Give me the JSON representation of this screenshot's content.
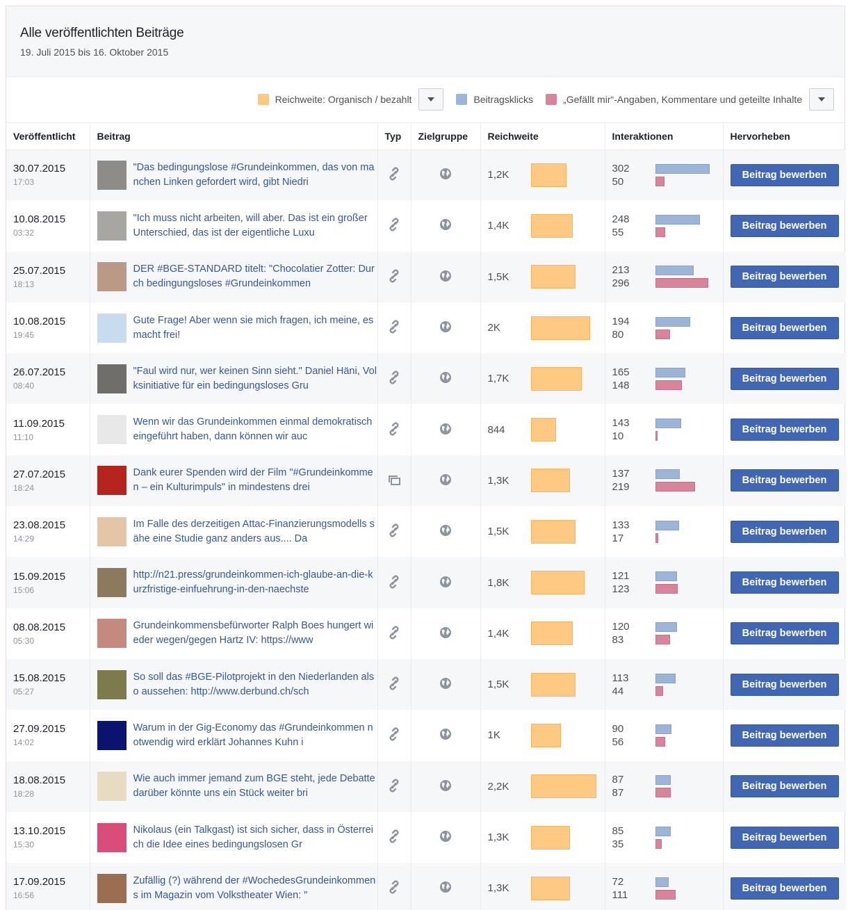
{
  "header": {
    "title": "Alle veröffentlichten Beiträge",
    "date_range": "19. Juli 2015 bis 16. Oktober 2015"
  },
  "legend": {
    "reach_label": "Reichweite: Organisch / bezahlt",
    "clicks_label": "Beitragsklicks",
    "engagement_label": "„Gefällt mir“-Angaben, Kommentare und geteilte Inhalte",
    "colors": {
      "reach": "#fec983",
      "clicks": "#9cb4d8",
      "engagement": "#d8849a"
    }
  },
  "columns": [
    "Veröffentlicht",
    "Beitrag",
    "Typ",
    "Zielgruppe",
    "Reichweite",
    "Interaktionen",
    "Hervorheben"
  ],
  "boost_label": "Beitrag bewerben",
  "rows": [
    {
      "date": "30.07.2015",
      "time": "17:03",
      "text": "\"Das bedingungslose #Grundeinkommen, das von manchen Linken gefordert wird, gibt Niedri",
      "type_icon": "link-icon",
      "reach": "1,2K",
      "reach_value": 1200,
      "clicks": 302,
      "engagement": 50,
      "thumb": "#8d8c88"
    },
    {
      "date": "10.08.2015",
      "time": "03:32",
      "text": "\"Ich muss nicht arbeiten, will aber. Das ist ein großer Unterschied, das ist der eigentliche Luxu",
      "type_icon": "link-icon",
      "reach": "1,4K",
      "reach_value": 1400,
      "clicks": 248,
      "engagement": 55,
      "thumb": "#a8a6a2"
    },
    {
      "date": "25.07.2015",
      "time": "18:13",
      "text": "DER #BGE-STANDARD titelt: \"Chocolatier Zotter: Durch bedingungsloses #Grundeinkommen",
      "type_icon": "link-icon",
      "reach": "1,5K",
      "reach_value": 1500,
      "clicks": 213,
      "engagement": 296,
      "thumb": "#b89a86"
    },
    {
      "date": "10.08.2015",
      "time": "19:45",
      "text": "Gute Frage! Aber wenn sie mich fragen, ich meine, es macht frei!",
      "type_icon": "link-icon",
      "reach": "2K",
      "reach_value": 2000,
      "clicks": 194,
      "engagement": 80,
      "thumb": "#c9dbef"
    },
    {
      "date": "26.07.2015",
      "time": "08:40",
      "text": "\"Faul wird nur, wer keinen Sinn sieht.\" Daniel Häni, Volksinitiative für ein bedingungsloses Gru",
      "type_icon": "link-icon",
      "reach": "1,7K",
      "reach_value": 1700,
      "clicks": 165,
      "engagement": 148,
      "thumb": "#6f6e6a"
    },
    {
      "date": "11.09.2015",
      "time": "11:10",
      "text": "Wenn wir das Grundeinkommen einmal demokratisch eingeführt haben, dann können wir auc",
      "type_icon": "link-icon",
      "reach": "844",
      "reach_value": 844,
      "clicks": 143,
      "engagement": 10,
      "thumb": "#e8e8e8"
    },
    {
      "date": "27.07.2015",
      "time": "18:24",
      "text": "Dank eurer Spenden wird der Film \"#Grundeinkommen – ein Kulturimpuls\" in mindestens drei",
      "type_icon": "album-icon",
      "reach": "1,3K",
      "reach_value": 1300,
      "clicks": 137,
      "engagement": 219,
      "thumb": "#b5241c"
    },
    {
      "date": "23.08.2015",
      "time": "14:29",
      "text": "Im Falle des derzeitigen Attac-Finanzierungsmodells sähe eine Studie ganz anders aus.... Da",
      "type_icon": "link-icon",
      "reach": "1,5K",
      "reach_value": 1500,
      "clicks": 133,
      "engagement": 17,
      "thumb": "#e3c6a8"
    },
    {
      "date": "15.09.2015",
      "time": "15:06",
      "text": "http://n21.press/grundeinkommen-ich-glaube-an-die-kurzfristige-einfuehrung-in-den-naechste",
      "type_icon": "link-icon",
      "reach": "1,8K",
      "reach_value": 1800,
      "clicks": 121,
      "engagement": 123,
      "thumb": "#8b7a5e"
    },
    {
      "date": "08.08.2015",
      "time": "05:30",
      "text": "Grundeinkommensbefürworter Ralph Boes hungert wieder wegen/gegen Hartz IV: https://www",
      "type_icon": "link-icon",
      "reach": "1,4K",
      "reach_value": 1400,
      "clicks": 120,
      "engagement": 83,
      "thumb": "#c48a80"
    },
    {
      "date": "15.08.2015",
      "time": "05:27",
      "text": "So soll das #BGE-Pilotprojekt in den Niederlanden also aussehen: http://www.derbund.ch/sch",
      "type_icon": "link-icon",
      "reach": "1,5K",
      "reach_value": 1500,
      "clicks": 113,
      "engagement": 44,
      "thumb": "#7d7a4c"
    },
    {
      "date": "27.09.2015",
      "time": "14:02",
      "text": "Warum in der Gig-Economy das #Grundeinkommen notwendig wird erklärt Johannes Kuhn i",
      "type_icon": "link-icon",
      "reach": "1K",
      "reach_value": 1000,
      "clicks": 90,
      "engagement": 56,
      "thumb": "#0a1470"
    },
    {
      "date": "18.08.2015",
      "time": "18:28",
      "text": "Wie auch immer jemand zum BGE steht, jede Debatte darüber könnte uns ein Stück weiter bri",
      "type_icon": "link-icon",
      "reach": "2,2K",
      "reach_value": 2200,
      "clicks": 87,
      "engagement": 87,
      "thumb": "#e6dcc2"
    },
    {
      "date": "13.10.2015",
      "time": "15:30",
      "text": "Nikolaus (ein Talkgast) ist sich sicher, dass in Österreich die Idee eines bedingungslosen Gr",
      "type_icon": "link-icon",
      "reach": "1,3K",
      "reach_value": 1300,
      "clicks": 85,
      "engagement": 35,
      "thumb": "#d84c7a"
    },
    {
      "date": "17.09.2015",
      "time": "16:56",
      "text": "Zufällig (?) während der #WochedesGrundeinkommens im Magazin vom Volkstheater Wien: \"",
      "type_icon": "link-icon",
      "reach": "1,3K",
      "reach_value": 1300,
      "clicks": 72,
      "engagement": 111,
      "thumb": "#9b6e52"
    }
  ]
}
